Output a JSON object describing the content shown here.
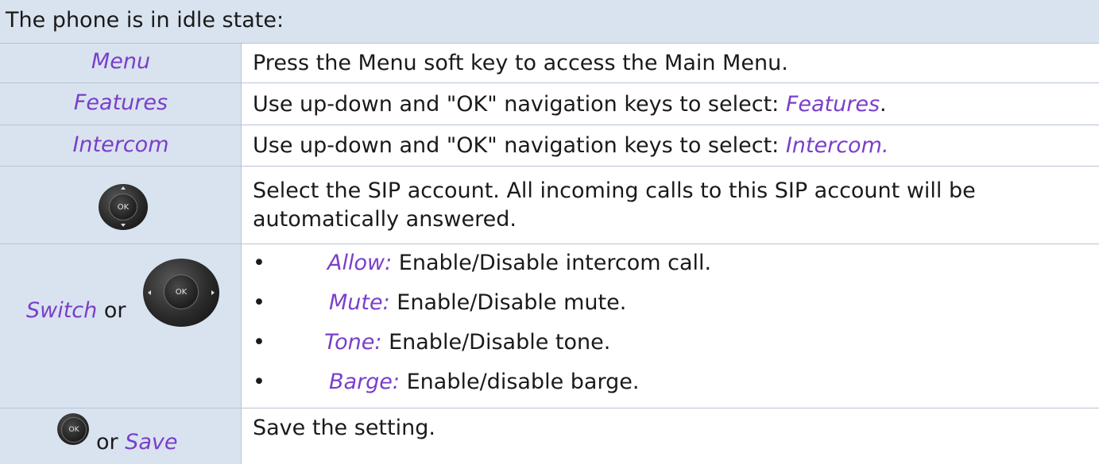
{
  "header": {
    "title": "The phone is in idle state:"
  },
  "rows": [
    {
      "label": "Menu",
      "text": "Press the Menu soft key to access the Main Menu."
    },
    {
      "label": "Features",
      "text_prefix": "Use up-down and \"OK\" navigation keys to select: ",
      "text_kw": "Features",
      "text_suffix": "."
    },
    {
      "label": "Intercom",
      "text_prefix": "Use up-down and \"OK\" navigation keys to select: ",
      "text_kw": "Intercom.",
      "text_suffix": ""
    },
    {
      "label_icon": "ok-navigation-key-icon",
      "key_text": "OK",
      "text_line1": "Select the SIP account. All incoming calls to this SIP account will be",
      "text_line2": "automatically answered."
    },
    {
      "label_kw": "Switch",
      "label_or": "or",
      "label_icon": "ok-navigation-key-icon",
      "key_text": "OK",
      "bullets": [
        {
          "dot": "•",
          "kw": "Allow:",
          "text": "Enable/Disable intercom call."
        },
        {
          "dot": "•",
          "kw": "Mute:",
          "text": "Enable/Disable mute."
        },
        {
          "dot": "•",
          "kw": "Tone:",
          "text": "Enable/Disable tone."
        },
        {
          "dot": "•",
          "kw": "Barge:",
          "text": "Enable/disable barge."
        }
      ]
    },
    {
      "label_icon": "ok-key-icon",
      "key_text": "OK",
      "label_or": "or",
      "label_kw": "Save",
      "text": "Save the setting."
    }
  ],
  "colors": {
    "header_bg": "#d9e3f0",
    "label_col_bg": "#d9e3f0",
    "keyword": "#7a3fc9",
    "border": "#b8c4d4"
  }
}
